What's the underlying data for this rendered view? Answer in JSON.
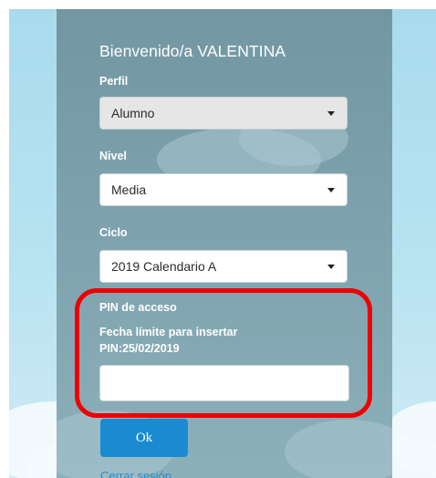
{
  "header": {
    "welcome": "Bienvenido/a VALENTINA"
  },
  "form": {
    "perfil": {
      "label": "Perfil",
      "value": "Alumno"
    },
    "nivel": {
      "label": "Nivel",
      "value": "Media"
    },
    "ciclo": {
      "label": "Ciclo",
      "value": "2019 Calendario A"
    },
    "pin": {
      "label": "PIN de acceso",
      "deadline_line1": "Fecha límite para insertar",
      "deadline_line2": "PIN:25/02/2019",
      "value": ""
    }
  },
  "actions": {
    "ok_label": "Ok",
    "logout_label": "Cerrar sesión"
  },
  "colors": {
    "accent": "#1a8bd1",
    "highlight": "#ee0000",
    "panel": "#7a9ea9",
    "sky": "#b5e1f0"
  }
}
